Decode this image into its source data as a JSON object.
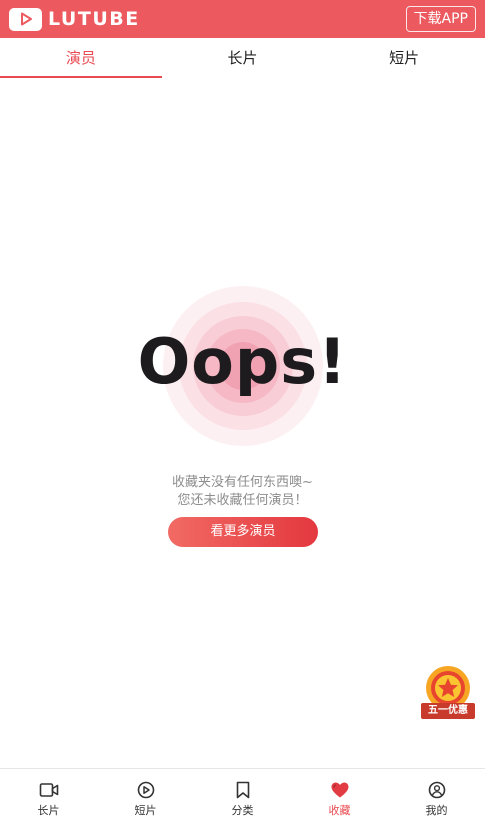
{
  "header": {
    "logo_text": "LUTUBE",
    "download_label": "下载APP"
  },
  "tabs": [
    {
      "label": "演员",
      "active": true
    },
    {
      "label": "长片",
      "active": false
    },
    {
      "label": "短片",
      "active": false
    }
  ],
  "empty_state": {
    "title": "Oops!",
    "message_line1": "收藏夹没有任何东西噢~",
    "message_line2": "您还未收藏任何演员！",
    "cta_label": "看更多演员"
  },
  "promo": {
    "label": "五一优惠",
    "icon": "star-medal-icon"
  },
  "bottom_nav": [
    {
      "label": "长片",
      "icon": "video-camera-icon",
      "active": false
    },
    {
      "label": "短片",
      "icon": "play-circle-icon",
      "active": false
    },
    {
      "label": "分类",
      "icon": "bookmark-icon",
      "active": false
    },
    {
      "label": "收藏",
      "icon": "heart-icon",
      "active": true
    },
    {
      "label": "我的",
      "icon": "user-icon",
      "active": false
    }
  ],
  "colors": {
    "brand": "#ec5a5f",
    "accent": "#e94b52",
    "text_muted": "#8d8d8d"
  }
}
